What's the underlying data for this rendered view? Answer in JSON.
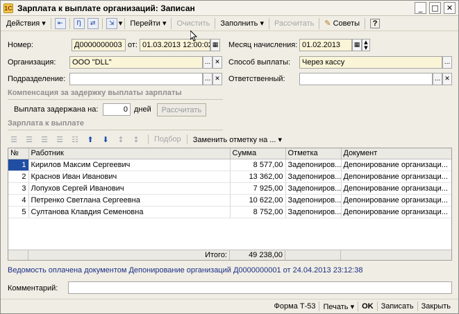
{
  "window": {
    "title": "Зарплата к выплате организаций: Записан",
    "app_icon": "1c-document-icon",
    "minimize": "_",
    "maximize": "□",
    "close": "✕"
  },
  "toolbar": {
    "actions": "Действия",
    "goto": "Перейти",
    "clear": "Очистить",
    "fill": "Заполнить",
    "calculate": "Рассчитать",
    "tips": "Советы",
    "help": "?"
  },
  "form": {
    "number_label": "Номер:",
    "number_value": "Д0000000003",
    "from_label": "от:",
    "date_value": "01.03.2013 12:00:02",
    "month_label": "Месяц начисления:",
    "month_value": "01.02.2013",
    "org_label": "Организация:",
    "org_value": "ООО \"DLL\"",
    "payment_label": "Способ выплаты:",
    "payment_value": "Через кассу",
    "dept_label": "Подразделение:",
    "dept_value": "",
    "responsible_label": "Ответственный:",
    "responsible_value": "",
    "ellipsis": "...",
    "clear_x": "✕"
  },
  "compensation": {
    "title": "Компенсация за задержку выплаты зарплаты",
    "delay_label": "Выплата задержана на:",
    "delay_value": "0",
    "days_label": "дней",
    "calc_button": "Рассчитать"
  },
  "payout": {
    "title": "Зарплата к выплате",
    "selection": "Подбор",
    "replace_mark": "Заменить отметку на ...",
    "columns": [
      "№",
      "Работник",
      "Сумма",
      "Отметка",
      "Документ"
    ],
    "rows": [
      {
        "n": "1",
        "worker": "Кирилов Максим Сергеевич",
        "sum": "8 577,00",
        "mark": "Задепониров...",
        "doc": "Депонирование организаци..."
      },
      {
        "n": "2",
        "worker": "Краснов Иван Иванович",
        "sum": "13 362,00",
        "mark": "Задепониров...",
        "doc": "Депонирование организаци..."
      },
      {
        "n": "3",
        "worker": "Лопухов Сергей Иванович",
        "sum": "7 925,00",
        "mark": "Задепониров...",
        "doc": "Депонирование организаци..."
      },
      {
        "n": "4",
        "worker": "Петренко Светлана Сергеевна",
        "sum": "10 622,00",
        "mark": "Задепониров...",
        "doc": "Депонирование организаци..."
      },
      {
        "n": "5",
        "worker": "Султанова Клавдия Семеновна",
        "sum": "8 752,00",
        "mark": "Задепониров...",
        "doc": "Депонирование организаци..."
      }
    ],
    "total_label": "Итого:",
    "total_value": "49 238,00"
  },
  "info_line": "Ведомость оплачена документом Депонирование организаций Д0000000001 от 24.04.2013 23:12:38",
  "comment_label": "Комментарий:",
  "comment_value": "",
  "bottom": {
    "form_t53": "Форма Т-53",
    "print": "Печать",
    "ok": "OK",
    "save": "Записать",
    "close": "Закрыть"
  }
}
